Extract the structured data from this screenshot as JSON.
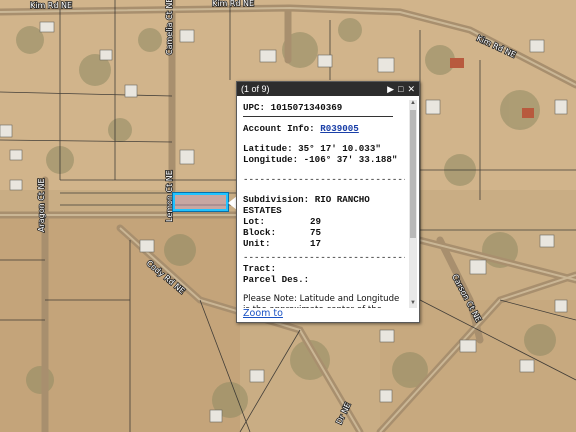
{
  "map": {
    "roads": [
      "Kim Rd NE",
      "Kim Rd NE",
      "Kim Rd NE",
      "Camelia Ct NE",
      "Aragon Ct NE",
      "Lemon Ct NE",
      "Cody Rd NE",
      "Carson Ct NE",
      "Dr NE"
    ]
  },
  "popup": {
    "count": "(1 of 9)",
    "upc_label": "UPC:",
    "upc_value": "1015071340369",
    "account_label": "Account Info:",
    "account_value": "R039005",
    "lat_label": "Latitude:",
    "lat_value": "35° 17' 10.033\"",
    "lon_label": "Longitude:",
    "lon_value": "-106° 37' 33.188\"",
    "separator": "------------------------------",
    "subdivision_label": "Subdivision:",
    "subdivision_value": "RIO RANCHO",
    "subdivision_value2": "ESTATES",
    "lot_label": "Lot:",
    "lot_value": "29",
    "block_label": "Block:",
    "block_value": "75",
    "unit_label": "Unit:",
    "unit_value": "17",
    "tract_label": "Tract:",
    "parcel_des_label": "Parcel Des.:",
    "note": "Please Note: Latitude and Longitude is the approximate center of the parcel shown",
    "zoom_link": "Zoom to"
  }
}
